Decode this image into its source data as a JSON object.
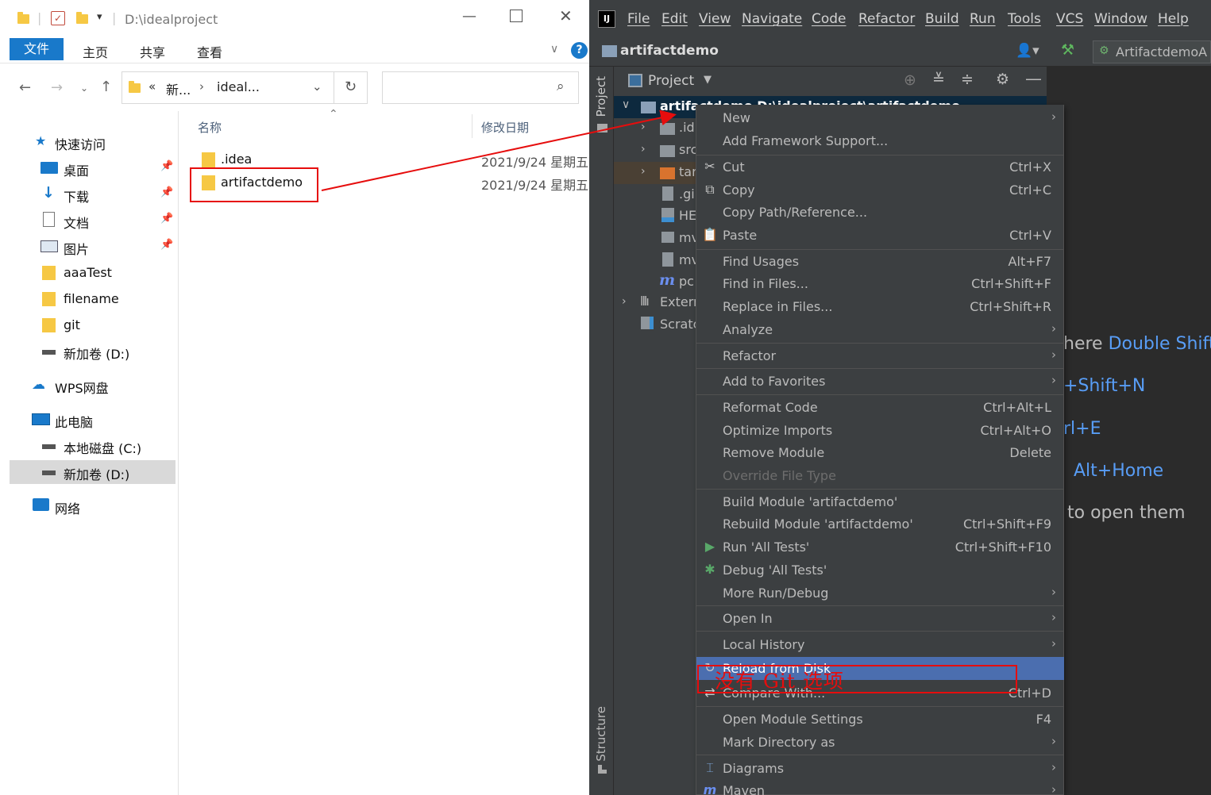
{
  "explorer": {
    "title_path": "D:\\idealproject",
    "ribbon_tabs": {
      "file": "文件",
      "home": "主页",
      "share": "共享",
      "view": "查看"
    },
    "address": {
      "prefix": "«",
      "seg1": "新...",
      "sep": "›",
      "seg2": "ideal..."
    },
    "search_placeholder": "",
    "nav": {
      "quick_access": "快速访问",
      "items": [
        {
          "label": "桌面",
          "pinned": true
        },
        {
          "label": "下载",
          "pinned": true
        },
        {
          "label": "文档",
          "pinned": true
        },
        {
          "label": "图片",
          "pinned": true
        },
        {
          "label": "aaaTest",
          "pinned": false
        },
        {
          "label": "filename",
          "pinned": false
        },
        {
          "label": "git",
          "pinned": false
        },
        {
          "label": "新加卷 (D:)",
          "pinned": false
        }
      ],
      "wps": "WPS网盘",
      "this_pc": "此电脑",
      "pc_items": [
        "本地磁盘 (C:)",
        "新加卷 (D:)"
      ],
      "network": "网络"
    },
    "columns": {
      "name": "名称",
      "modified": "修改日期"
    },
    "files": [
      {
        "name": ".idea",
        "modified": "2021/9/24 星期五"
      },
      {
        "name": "artifactdemo",
        "modified": "2021/9/24 星期五"
      }
    ]
  },
  "ide": {
    "menubar": [
      "File",
      "Edit",
      "View",
      "Navigate",
      "Code",
      "Refactor",
      "Build",
      "Run",
      "Tools",
      "VCS",
      "Window",
      "Help"
    ],
    "project_name": "artifactdemo",
    "run_config": "ArtifactdemoA",
    "project_tab": "Project",
    "side_project": "Project",
    "side_structure": "Structure",
    "tree": [
      {
        "text": "artifactdemo  D:\\idealproject\\artifactdemo"
      },
      {
        "text": ".id"
      },
      {
        "text": "src"
      },
      {
        "text": "tar"
      },
      {
        "text": ".gi"
      },
      {
        "text": "HE"
      },
      {
        "text": "mv"
      },
      {
        "text": "mv"
      },
      {
        "text": "pc"
      },
      {
        "text": "Extern"
      },
      {
        "text": "Scratc"
      }
    ],
    "hints": {
      "h1a": "here",
      "h1b": "Double Shift",
      "h2": "+Shift+N",
      "h3": "rl+E",
      "h4": "Alt+Home",
      "h5": "to open them"
    }
  },
  "context_menu": [
    {
      "label": "New",
      "shortcut": "",
      "submenu": true
    },
    {
      "label": "Add Framework Support...",
      "shortcut": "",
      "submenu": false
    },
    {
      "label": "Cut",
      "shortcut": "Ctrl+X",
      "submenu": false,
      "icon": "✂"
    },
    {
      "label": "Copy",
      "shortcut": "Ctrl+C",
      "submenu": false,
      "icon": "⧉"
    },
    {
      "label": "Copy Path/Reference...",
      "shortcut": "",
      "submenu": false
    },
    {
      "label": "Paste",
      "shortcut": "Ctrl+V",
      "submenu": false,
      "icon": "📋"
    },
    {
      "label": "Find Usages",
      "shortcut": "Alt+F7",
      "submenu": false
    },
    {
      "label": "Find in Files...",
      "shortcut": "Ctrl+Shift+F",
      "submenu": false
    },
    {
      "label": "Replace in Files...",
      "shortcut": "Ctrl+Shift+R",
      "submenu": false
    },
    {
      "label": "Analyze",
      "shortcut": "",
      "submenu": true
    },
    {
      "label": "Refactor",
      "shortcut": "",
      "submenu": true
    },
    {
      "label": "Add to Favorites",
      "shortcut": "",
      "submenu": true
    },
    {
      "label": "Reformat Code",
      "shortcut": "Ctrl+Alt+L",
      "submenu": false
    },
    {
      "label": "Optimize Imports",
      "shortcut": "Ctrl+Alt+O",
      "submenu": false
    },
    {
      "label": "Remove Module",
      "shortcut": "Delete",
      "submenu": false
    },
    {
      "label": "Override File Type",
      "shortcut": "",
      "submenu": false,
      "disabled": true
    },
    {
      "label": "Build Module 'artifactdemo'",
      "shortcut": "",
      "submenu": false
    },
    {
      "label": "Rebuild Module 'artifactdemo'",
      "shortcut": "Ctrl+Shift+F9",
      "submenu": false
    },
    {
      "label": "Run 'All Tests'",
      "shortcut": "Ctrl+Shift+F10",
      "submenu": false,
      "icon": "▶"
    },
    {
      "label": "Debug 'All Tests'",
      "shortcut": "",
      "submenu": false,
      "icon": "✱"
    },
    {
      "label": "More Run/Debug",
      "shortcut": "",
      "submenu": true
    },
    {
      "label": "Open In",
      "shortcut": "",
      "submenu": true
    },
    {
      "label": "Local History",
      "shortcut": "",
      "submenu": true
    },
    {
      "label": "Reload from Disk",
      "shortcut": "",
      "submenu": false,
      "selected": true,
      "icon": "↻"
    },
    {
      "label": "Compare With...",
      "shortcut": "Ctrl+D",
      "submenu": false,
      "icon": "⇄"
    },
    {
      "label": "Open Module Settings",
      "shortcut": "F4",
      "submenu": false
    },
    {
      "label": "Mark Directory as",
      "shortcut": "",
      "submenu": true
    },
    {
      "label": "Diagrams",
      "shortcut": "",
      "submenu": true,
      "icon": "⌶"
    },
    {
      "label": "Maven",
      "shortcut": "",
      "submenu": true,
      "icon": "m"
    }
  ],
  "annotation": "没有    Git  选项",
  "colors": {
    "selection": "#4b6eaf",
    "annotation_red": "#e60d0d",
    "explorer_accent": "#1979ca",
    "ide_link": "#589df6"
  }
}
